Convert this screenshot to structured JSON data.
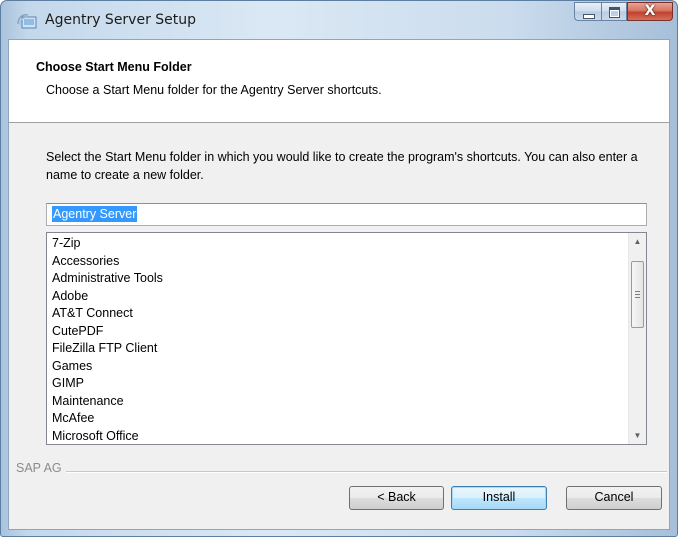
{
  "window": {
    "title": "Agentry Server Setup",
    "icon": "installer-icon",
    "controls": {
      "minimize": "minimize-icon",
      "maximize": "maximize-icon",
      "close": "close-icon",
      "close_glyph": "X"
    }
  },
  "header": {
    "title": "Choose Start Menu Folder",
    "subtitle": "Choose a Start Menu folder for the Agentry Server shortcuts."
  },
  "instructions": "Select the Start Menu folder in which you would like to create the program's shortcuts. You can also enter a name to create a new folder.",
  "folder_input": {
    "value": "Agentry Server"
  },
  "folder_list": {
    "items": [
      "7-Zip",
      "Accessories",
      "Administrative Tools",
      "Adobe",
      "AT&T Connect",
      "CutePDF",
      "FileZilla FTP Client",
      "Games",
      "GIMP",
      "Maintenance",
      "McAfee",
      "Microsoft Office"
    ]
  },
  "vendor": "SAP AG",
  "buttons": {
    "back": "< Back",
    "install": "Install",
    "cancel": "Cancel"
  },
  "colors": {
    "selection": "#3399ff",
    "close_button": "#c24130",
    "default_button_border": "#3c7fb1"
  }
}
